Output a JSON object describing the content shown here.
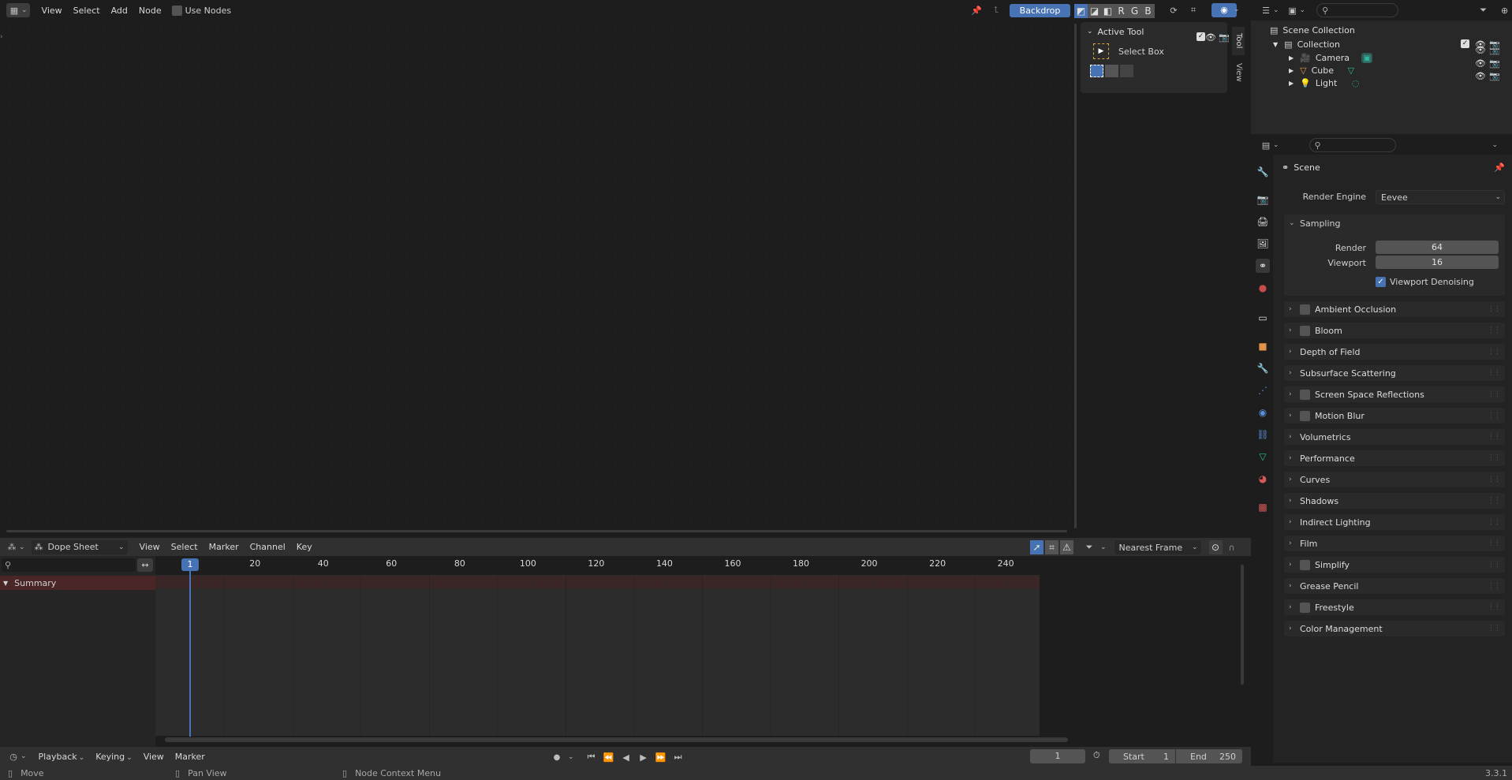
{
  "node_editor": {
    "menu": [
      "View",
      "Select",
      "Add",
      "Node"
    ],
    "use_nodes_label": "Use Nodes",
    "backdrop_label": "Backdrop",
    "channel_buttons": [
      "R",
      "G",
      "B"
    ],
    "tabs": [
      "Tool",
      "View"
    ],
    "active_tool_title": "Active Tool",
    "active_tool_name": "Select Box"
  },
  "outliner": {
    "root": "Scene Collection",
    "collection": "Collection",
    "items": [
      {
        "name": "Camera",
        "icon": "camera-icon"
      },
      {
        "name": "Cube",
        "icon": "mesh-icon"
      },
      {
        "name": "Light",
        "icon": "light-icon"
      }
    ]
  },
  "properties": {
    "context": "Scene",
    "render_engine_label": "Render Engine",
    "render_engine_value": "Eevee",
    "sampling": {
      "title": "Sampling",
      "render_label": "Render",
      "render_value": "64",
      "viewport_label": "Viewport",
      "viewport_value": "16",
      "denoise_label": "Viewport Denoising"
    },
    "panels": [
      {
        "label": "Ambient Occlusion",
        "checkbox": true
      },
      {
        "label": "Bloom",
        "checkbox": true
      },
      {
        "label": "Depth of Field",
        "checkbox": false
      },
      {
        "label": "Subsurface Scattering",
        "checkbox": false
      },
      {
        "label": "Screen Space Reflections",
        "checkbox": true
      },
      {
        "label": "Motion Blur",
        "checkbox": true
      },
      {
        "label": "Volumetrics",
        "checkbox": false
      },
      {
        "label": "Performance",
        "checkbox": false
      },
      {
        "label": "Curves",
        "checkbox": false
      },
      {
        "label": "Shadows",
        "checkbox": false
      },
      {
        "label": "Indirect Lighting",
        "checkbox": false
      },
      {
        "label": "Film",
        "checkbox": false
      },
      {
        "label": "Simplify",
        "checkbox": true
      },
      {
        "label": "Grease Pencil",
        "checkbox": false
      },
      {
        "label": "Freestyle",
        "checkbox": true
      },
      {
        "label": "Color Management",
        "checkbox": false
      }
    ]
  },
  "dopesheet": {
    "mode": "Dope Sheet",
    "menu": [
      "View",
      "Select",
      "Marker",
      "Channel",
      "Key"
    ],
    "snap": "Nearest Frame",
    "summary": "Summary",
    "current_frame_badge": "1",
    "ticks": [
      "20",
      "40",
      "60",
      "80",
      "100",
      "120",
      "140",
      "160",
      "180",
      "200",
      "220",
      "240"
    ]
  },
  "timeline": {
    "menu": [
      "Playback",
      "Keying",
      "View",
      "Marker"
    ],
    "current_frame": "1",
    "start_label": "Start",
    "start_value": "1",
    "end_label": "End",
    "end_value": "250"
  },
  "statusbar": {
    "items": [
      "Move",
      "Pan View",
      "Node Context Menu"
    ],
    "version": "3.3.1"
  },
  "colors": {
    "accent": "#4772b3",
    "bg": "#1d1d1d",
    "header": "#303030"
  }
}
